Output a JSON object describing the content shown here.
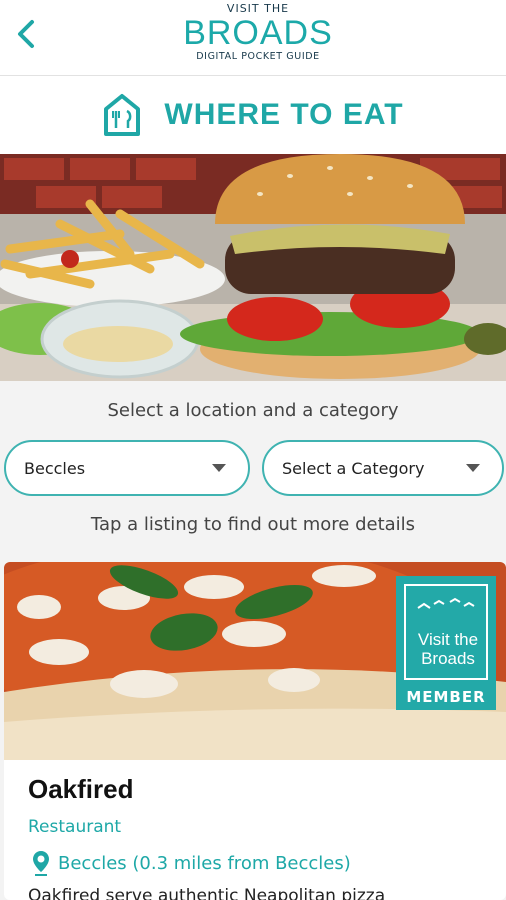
{
  "header": {
    "brand_top": "VISIT THE",
    "brand_main": "BROADS",
    "brand_sub": "DIGITAL POCKET GUIDE"
  },
  "section": {
    "title": "WHERE TO EAT",
    "icon": "restaurant-house-icon"
  },
  "filters": {
    "prompt": "Select a location and a category",
    "location_value": "Beccles",
    "category_value": "Select a Category",
    "hint": "Tap a listing to find out more details"
  },
  "listing": {
    "badge_line1": "Visit the",
    "badge_line2": "Broads",
    "badge_member": "MEMBER",
    "name": "Oakfired",
    "category": "Restaurant",
    "location": "Beccles (0.3 miles from Beccles)",
    "description": "Oakfired serve authentic Neapolitan pizza"
  },
  "colors": {
    "accent": "#1fa7a6",
    "navy": "#17384a"
  }
}
